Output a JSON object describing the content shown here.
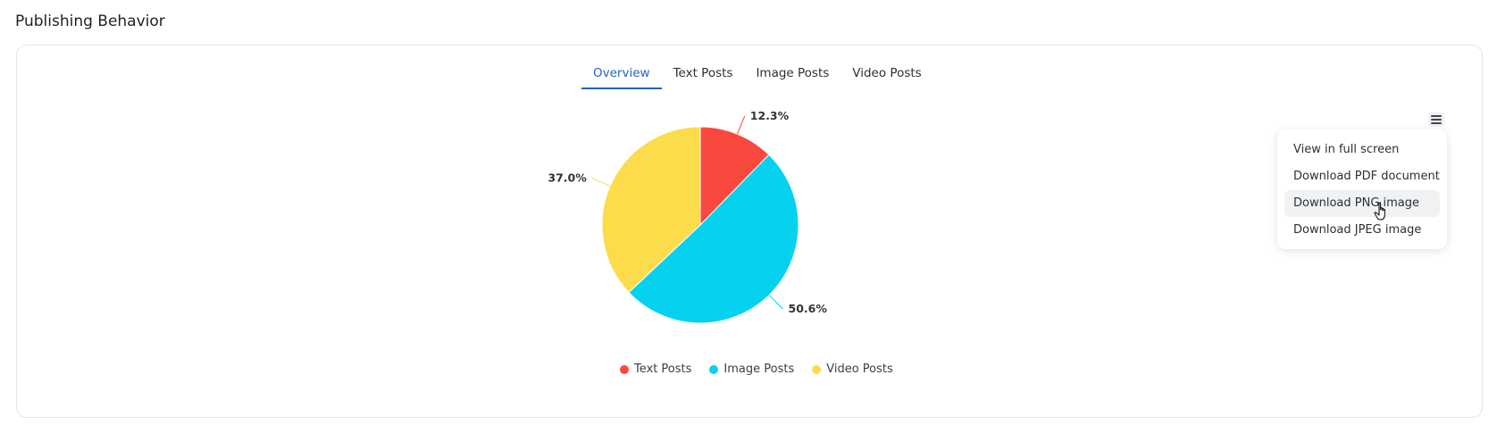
{
  "section_title": "Publishing Behavior",
  "tabs": [
    {
      "label": "Overview",
      "active": true
    },
    {
      "label": "Text Posts",
      "active": false
    },
    {
      "label": "Image Posts",
      "active": false
    },
    {
      "label": "Video Posts",
      "active": false
    }
  ],
  "menu": {
    "icon": "hamburger-icon",
    "items": [
      "View in full screen",
      "Download PDF document",
      "Download PNG image",
      "Download JPEG image"
    ],
    "hovered_index": 2
  },
  "chart_data": {
    "type": "pie",
    "categories": [
      "Text Posts",
      "Image Posts",
      "Video Posts"
    ],
    "values": [
      12.3,
      50.6,
      37.0
    ],
    "data_labels": [
      "12.3%",
      "50.6%",
      "37.0%"
    ],
    "colors": [
      "#f9493f",
      "#06d2ef",
      "#fcdc4b"
    ],
    "title": "",
    "legend": "bottom-center"
  }
}
